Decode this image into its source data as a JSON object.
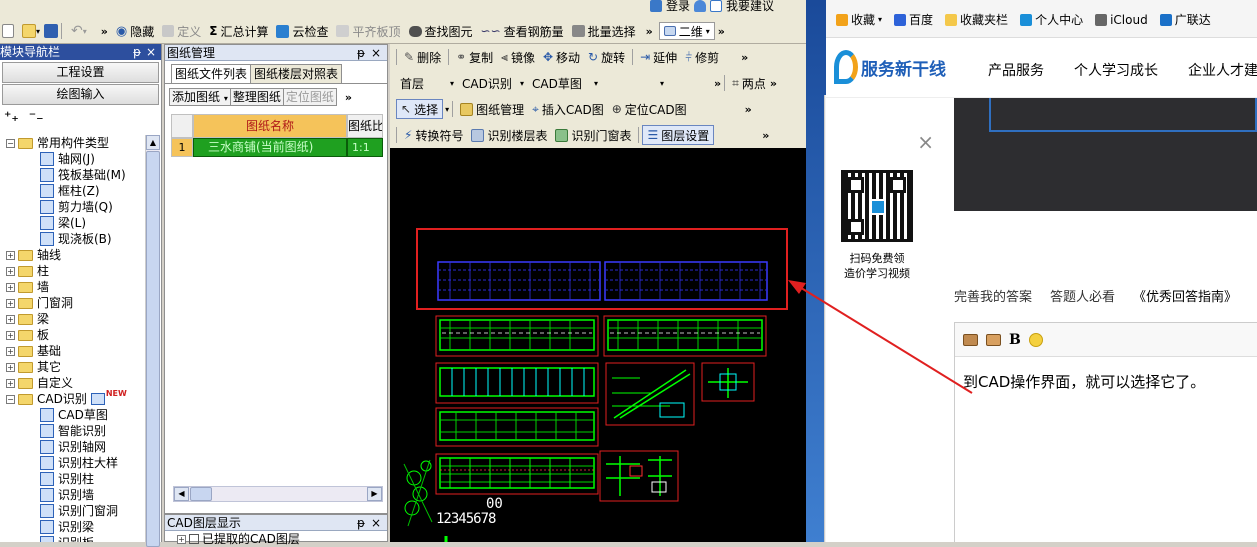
{
  "top_right": {
    "login": "登录",
    "feedback": "我要建议"
  },
  "toolbar1": {
    "hide": "隐藏",
    "define": "定义",
    "sum_calc": "汇总计算",
    "cloud_check": "云检查",
    "level_slab": "平齐板顶",
    "find_elem": "查找图元",
    "view_rebar": "查看钢筋量",
    "batch_select": "批量选择",
    "view_mode": "二维"
  },
  "left_nav": {
    "title": "模块导航栏",
    "pin": "ᵽ",
    "close": "×",
    "project_settings": "工程设置",
    "drawing_input": "绘图输入",
    "tree": [
      {
        "label": "常用构件类型",
        "level": 0,
        "expanded": true
      },
      {
        "label": "轴网(J)",
        "level": 1
      },
      {
        "label": "筏板基础(M)",
        "level": 1
      },
      {
        "label": "框柱(Z)",
        "level": 1
      },
      {
        "label": "剪力墙(Q)",
        "level": 1
      },
      {
        "label": "梁(L)",
        "level": 1
      },
      {
        "label": "现浇板(B)",
        "level": 1
      },
      {
        "label": "轴线",
        "level": 0
      },
      {
        "label": "柱",
        "level": 0
      },
      {
        "label": "墙",
        "level": 0
      },
      {
        "label": "门窗洞",
        "level": 0
      },
      {
        "label": "梁",
        "level": 0
      },
      {
        "label": "板",
        "level": 0
      },
      {
        "label": "基础",
        "level": 0
      },
      {
        "label": "其它",
        "level": 0
      },
      {
        "label": "自定义",
        "level": 0
      },
      {
        "label": "CAD识别",
        "level": 0,
        "expanded": true,
        "badge": "NEW"
      },
      {
        "label": "CAD草图",
        "level": 1
      },
      {
        "label": "智能识别",
        "level": 1
      },
      {
        "label": "识别轴网",
        "level": 1
      },
      {
        "label": "识别柱大样",
        "level": 1
      },
      {
        "label": "识别柱",
        "level": 1
      },
      {
        "label": "识别墙",
        "level": 1
      },
      {
        "label": "识别门窗洞",
        "level": 1
      },
      {
        "label": "识别梁",
        "level": 1
      },
      {
        "label": "识别板",
        "level": 1
      }
    ]
  },
  "drawing_mgmt": {
    "title": "图纸管理",
    "pin": "ᵽ",
    "close": "×",
    "tab_list": "图纸文件列表",
    "tab_layer": "图纸楼层对照表",
    "btn_add": "添加图纸",
    "btn_arrange": "整理图纸",
    "btn_locate": "定位图纸",
    "col_name": "图纸名称",
    "col_ratio": "图纸比",
    "row_index": "1",
    "row_name": "三水商铺(当前图纸)",
    "row_ratio": "1:1"
  },
  "cad_layer": {
    "title": "CAD图层显示",
    "pin": "ᵽ",
    "close": "×",
    "item": "已提取的CAD图层"
  },
  "edit_bar": {
    "delete": "删除",
    "copy": "复制",
    "mirror": "镜像",
    "move": "移动",
    "rotate": "旋转",
    "extend": "延伸",
    "trim": "修剪"
  },
  "combo_bar": {
    "floor": "首层",
    "cad_recog": "CAD识别",
    "cad_draft": "CAD草图",
    "blank": "",
    "two_point": "两点"
  },
  "select_bar": {
    "select": "选择",
    "drawing_mgmt": "图纸管理",
    "insert_cad": "插入CAD图",
    "locate_cad": "定位CAD图"
  },
  "recog_bar": {
    "convert_symbol": "转换符号",
    "recog_floor_table": "识别楼层表",
    "recog_door_table": "识别门窗表",
    "layer_settings": "图层设置"
  },
  "canvas_text": {
    "coord1": "00",
    "coord2": "12345678"
  },
  "browser": {
    "bookmarks": [
      {
        "label": "收藏",
        "icon": "star-icon"
      },
      {
        "label": "百度",
        "icon": "baidu-paw-icon"
      },
      {
        "label": "收藏夹栏",
        "icon": "folder-icon"
      },
      {
        "label": "个人中心",
        "icon": "person-icon"
      },
      {
        "label": "iCloud",
        "icon": "apple-icon"
      },
      {
        "label": "广联达",
        "icon": "g-logo-icon"
      }
    ],
    "logo": "服务新干线",
    "nav": [
      "产品服务",
      "个人学习成长",
      "企业人才建"
    ],
    "qr_close": "×",
    "qr_caption_1": "扫码免费领",
    "qr_caption_2": "造价学习视频",
    "links": {
      "improve": "完善我的答案",
      "must_see": "答题人必看",
      "guide": "《优秀回答指南》"
    },
    "editor_bold": "B",
    "answer_text": "到CAD操作界面，就可以选择它了。"
  },
  "colors": {
    "accent_blue": "#1f4fa0",
    "annotation_red": "#e02020",
    "cad_green": "#00ff00",
    "cad_blue": "#3a3aff"
  }
}
